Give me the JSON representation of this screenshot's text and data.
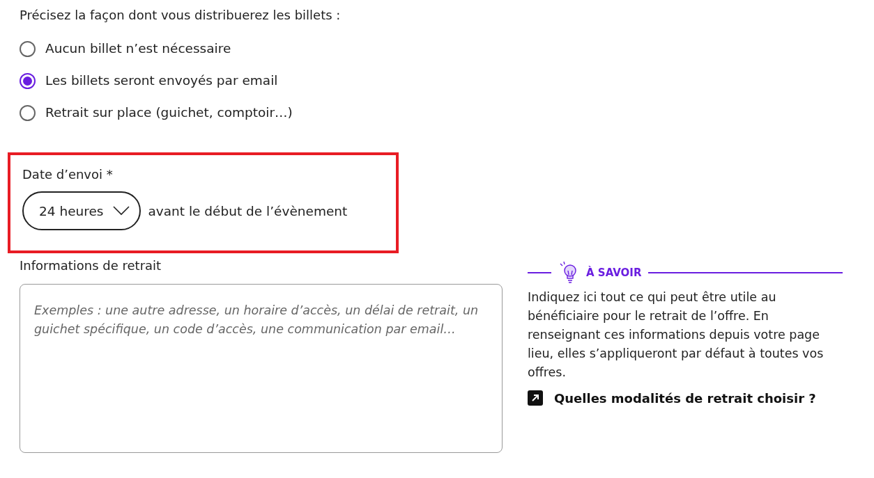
{
  "question": "Précisez la façon dont vous distribuerez les billets :",
  "options": [
    {
      "label": "Aucun billet n’est nécessaire",
      "selected": false
    },
    {
      "label": "Les billets seront envoyés par email",
      "selected": true
    },
    {
      "label": "Retrait sur place (guichet, comptoir…)",
      "selected": false
    }
  ],
  "send_date": {
    "highlighted": true,
    "label": "Date d’envoi *",
    "select_value": "24 heures",
    "suffix": "avant le début de l’évènement"
  },
  "withdrawal_info": {
    "label": "Informations de retrait",
    "placeholder": "Exemples : une autre adresse, un horaire d’accès, un délai de retrait, un guichet spécifique, un code d’accès, une communication par email…"
  },
  "tip": {
    "title": "À SAVOIR",
    "text": "Indiquez ici tout ce qui peut être utile au bénéficiaire pour le retrait de l’offre. En renseignant ces informations depuis votre page lieu, elles s’appliqueront par défaut à toutes vos offres.",
    "link": "Quelles modalités de retrait choisir ?"
  }
}
